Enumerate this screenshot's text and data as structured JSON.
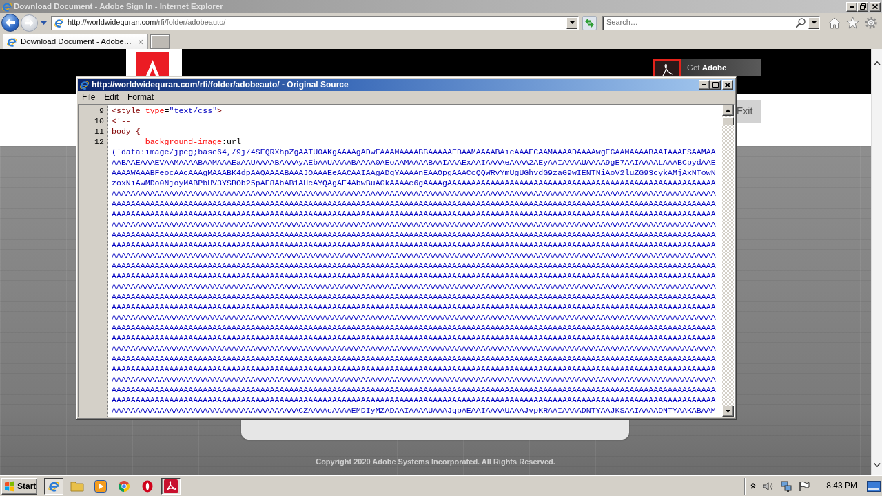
{
  "browser": {
    "title": "Download Document - Adobe Sign In - Internet Explorer",
    "address": {
      "host": "http://worldwidequran.com",
      "path": "/rfi/folder/adobeauto/"
    },
    "search": {
      "placeholder": "Search…"
    },
    "tabs": [
      {
        "label": "Download Document - Adobe…",
        "selected": true,
        "close": "×"
      }
    ]
  },
  "page": {
    "reader_badge": "Get **Adobe**",
    "exit_button": "Exit",
    "copyright": "Copyright 2020 Adobe Systems Incorporated. All Rights Reserved."
  },
  "source_window": {
    "title": "http://worldwidequran.com/rfi/folder/adobeauto/ - Original Source",
    "menu": [
      "File",
      "Edit",
      "Format"
    ],
    "lines": [
      {
        "number": "9",
        "tokens": [
          {
            "kind": "tag",
            "text": "<style"
          },
          {
            "kind": "attribute",
            "text": " type"
          },
          {
            "kind": "plain",
            "text": "="
          },
          {
            "kind": "string",
            "text": "\"text/css\""
          },
          {
            "kind": "tag",
            "text": ">"
          }
        ]
      },
      {
        "number": "10",
        "tokens": [
          {
            "kind": "tag",
            "text": "<!--"
          }
        ]
      },
      {
        "number": "11",
        "tokens": [
          {
            "kind": "tag",
            "text": "body {"
          }
        ]
      },
      {
        "number": "12",
        "tokens": [
          {
            "kind": "attribute",
            "text": "\tbackground-image"
          },
          {
            "kind": "plain",
            "text": ":url"
          }
        ],
        "continuation": {
          "kind": "string",
          "rows": [
            "('data:image/jpeg;base64,/9j/4SEQRXhpZgAATU0AKgAAAAgADwEAAAMAAAABBAAAAAEBAAMAAAABAicAAAECAAMAAAADAAAAwgEGAAMAAAABAAIAAAESAAMAA",
            "AABAAEAAAEVAAMAAAABAAMAAAEaAAUAAAABAAAAyAEbAAUAAAABAAAA0AEoAAMAAAABAAIAAAExAAIAAAAeAAAA2AEyAAIAAAAUAAAA9gE7AAIAAAALAAABCpydAAE",
            "AAAAWAAABFeocAAcAAAgMAAABK4dpAAQAAAABAAAJOAAAEeAACAAIAAgADqYAAAAnEAAOpgAAACcQQWRvYmUgUGhvdG9zaG9wIENTNiAoV2luZG93cykAMjAxNTowN",
            "zoxNiAwMDo0NjoyMABPbHV3YSBOb25pAE8AbAB1AHcAYQAgAE4AbwBuAGkAAAAc6gAAAAgAAAAAAAAAAAAAAAAAAAAAAAAAAAAAAAAAAAAAAAAAAAAAAAAAAAAAAAA",
            "AAAAAAAAAAAAAAAAAAAAAAAAAAAAAAAAAAAAAAAAAAAAAAAAAAAAAAAAAAAAAAAAAAAAAAAAAAAAAAAAAAAAAAAAAAAAAAAAAAAAAAAAAAAAAAAAAAAAAAAAAAAAAA",
            "AAAAAAAAAAAAAAAAAAAAAAAAAAAAAAAAAAAAAAAAAAAAAAAAAAAAAAAAAAAAAAAAAAAAAAAAAAAAAAAAAAAAAAAAAAAAAAAAAAAAAAAAAAAAAAAAAAAAAAAAAAAAAA",
            "AAAAAAAAAAAAAAAAAAAAAAAAAAAAAAAAAAAAAAAAAAAAAAAAAAAAAAAAAAAAAAAAAAAAAAAAAAAAAAAAAAAAAAAAAAAAAAAAAAAAAAAAAAAAAAAAAAAAAAAAAAAAAA",
            "AAAAAAAAAAAAAAAAAAAAAAAAAAAAAAAAAAAAAAAAAAAAAAAAAAAAAAAAAAAAAAAAAAAAAAAAAAAAAAAAAAAAAAAAAAAAAAAAAAAAAAAAAAAAAAAAAAAAAAAAAAAAAA",
            "AAAAAAAAAAAAAAAAAAAAAAAAAAAAAAAAAAAAAAAAAAAAAAAAAAAAAAAAAAAAAAAAAAAAAAAAAAAAAAAAAAAAAAAAAAAAAAAAAAAAAAAAAAAAAAAAAAAAAAAAAAAAAA",
            "AAAAAAAAAAAAAAAAAAAAAAAAAAAAAAAAAAAAAAAAAAAAAAAAAAAAAAAAAAAAAAAAAAAAAAAAAAAAAAAAAAAAAAAAAAAAAAAAAAAAAAAAAAAAAAAAAAAAAAAAAAAAAA",
            "AAAAAAAAAAAAAAAAAAAAAAAAAAAAAAAAAAAAAAAAAAAAAAAAAAAAAAAAAAAAAAAAAAAAAAAAAAAAAAAAAAAAAAAAAAAAAAAAAAAAAAAAAAAAAAAAAAAAAAAAAAAAAA",
            "AAAAAAAAAAAAAAAAAAAAAAAAAAAAAAAAAAAAAAAAAAAAAAAAAAAAAAAAAAAAAAAAAAAAAAAAAAAAAAAAAAAAAAAAAAAAAAAAAAAAAAAAAAAAAAAAAAAAAAAAAAAAAA",
            "AAAAAAAAAAAAAAAAAAAAAAAAAAAAAAAAAAAAAAAAAAAAAAAAAAAAAAAAAAAAAAAAAAAAAAAAAAAAAAAAAAAAAAAAAAAAAAAAAAAAAAAAAAAAAAAAAAAAAAAAAAAAAA",
            "AAAAAAAAAAAAAAAAAAAAAAAAAAAAAAAAAAAAAAAAAAAAAAAAAAAAAAAAAAAAAAAAAAAAAAAAAAAAAAAAAAAAAAAAAAAAAAAAAAAAAAAAAAAAAAAAAAAAAAAAAAAAAA",
            "AAAAAAAAAAAAAAAAAAAAAAAAAAAAAAAAAAAAAAAAAAAAAAAAAAAAAAAAAAAAAAAAAAAAAAAAAAAAAAAAAAAAAAAAAAAAAAAAAAAAAAAAAAAAAAAAAAAAAAAAAAAAAA",
            "AAAAAAAAAAAAAAAAAAAAAAAAAAAAAAAAAAAAAAAAAAAAAAAAAAAAAAAAAAAAAAAAAAAAAAAAAAAAAAAAAAAAAAAAAAAAAAAAAAAAAAAAAAAAAAAAAAAAAAAAAAAAAA",
            "AAAAAAAAAAAAAAAAAAAAAAAAAAAAAAAAAAAAAAAAAAAAAAAAAAAAAAAAAAAAAAAAAAAAAAAAAAAAAAAAAAAAAAAAAAAAAAAAAAAAAAAAAAAAAAAAAAAAAAAAAAAAAA",
            "AAAAAAAAAAAAAAAAAAAAAAAAAAAAAAAAAAAAAAAAAAAAAAAAAAAAAAAAAAAAAAAAAAAAAAAAAAAAAAAAAAAAAAAAAAAAAAAAAAAAAAAAAAAAAAAAAAAAAAAAAAAAAA",
            "AAAAAAAAAAAAAAAAAAAAAAAAAAAAAAAAAAAAAAAAAAAAAAAAAAAAAAAAAAAAAAAAAAAAAAAAAAAAAAAAAAAAAAAAAAAAAAAAAAAAAAAAAAAAAAAAAAAAAAAAAAAAAA",
            "AAAAAAAAAAAAAAAAAAAAAAAAAAAAAAAAAAAAAAAAAAAAAAAAAAAAAAAAAAAAAAAAAAAAAAAAAAAAAAAAAAAAAAAAAAAAAAAAAAAAAAAAAAAAAAAAAAAAAAAAAAAAAA",
            "AAAAAAAAAAAAAAAAAAAAAAAAAAAAAAAAAAAAAAAAAAAAAAAAAAAAAAAAAAAAAAAAAAAAAAAAAAAAAAAAAAAAAAAAAAAAAAAAAAAAAAAAAAAAAAAAAAAAAAAAAAAAAA",
            "AAAAAAAAAAAAAAAAAAAAAAAAAAAAAAAAAAAAAAAAAAAAAAAAAAAAAAAAAAAAAAAAAAAAAAAAAAAAAAAAAAAAAAAAAAAAAAAAAAAAAAAAAAAAAAAAAAAAAAAAAAAAAA",
            "AAAAAAAAAAAAAAAAAAAAAAAAAAAAAAAAAAAAAAAAAAAAAAAAAAAAAAAAAAAAAAAAAAAAAAAAAAAAAAAAAAAAAAAAAAAAAAAAAAAAAAAAAAAAAAAAAAAAAAAAAAAAAA",
            "AAAAAAAAAAAAAAAAAAAAAAAAAAAAAAAAAAAAAAAAAAAAAAAAAAAAAAAAAAAAAAAAAAAAAAAAAAAAAAAAAAAAAAAAAAAAAAAAAAAAAAAAAAAAAAAAAAAAAAAAAAAAAA",
            "AAAAAAAAAAAAAAAAAAAAAAAAAAAAAAAAAAAAAAAAAAAAAAAAAAAAAAAAAAAAAAAAAAAAAAAAAAAAAAAAAAAAAAAAAAAAAAAAAAAAAAAAAAAAAAAAAAAAAAAAAAAAAA",
            "AAAAAAAAAAAAAAAAAAAAAAAAAAAAAAAAAAAAAAACZAAAAcAAAAEMDIyMZADAAIAAAAUAAAJqpAEAAIAAAAUAAAJvpKRAAIAAAADNTYAAJKSAAIAAAADNTYAAKABAAM"
          ]
        }
      }
    ]
  },
  "taskbar": {
    "start": "Start",
    "apps": [
      {
        "kind": "browser",
        "active": true
      },
      {
        "kind": "folder",
        "active": false
      },
      {
        "kind": "player",
        "active": false
      },
      {
        "kind": "wheel",
        "active": false
      },
      {
        "kind": "ring",
        "active": false
      },
      {
        "kind": "reader",
        "active": true
      }
    ],
    "clock": "8:43 PM"
  }
}
